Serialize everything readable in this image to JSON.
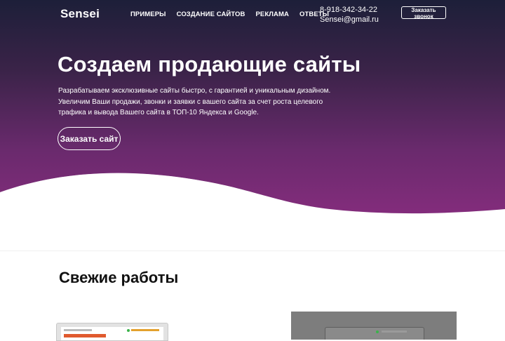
{
  "header": {
    "logo": "Sensei",
    "nav": [
      {
        "label": "ПРИМЕРЫ"
      },
      {
        "label": "СОЗДАНИЕ САЙТОВ"
      },
      {
        "label": "РЕКЛАМА"
      },
      {
        "label": "ОТВЕТЫ"
      }
    ],
    "phone": "8-918-342-34-22",
    "email": "Sensei@gmail.ru",
    "call_button": "Заказать звонок"
  },
  "hero": {
    "title": "Создаем продающие сайты",
    "description": "Разрабатываем эксклюзивные сайты быстро, с гарантией и уникальным дизайном. Увеличим Ваши продажи, звонки и заявки с вашего сайта за счет роста целевого трафика и вывода Вашего сайта в ТОП-10 Яндекса и Google.",
    "order_button": "Заказать сайт"
  },
  "works": {
    "title": "Свежие работы"
  },
  "colors": {
    "hero_top": "#1d1f39",
    "hero_bottom": "#8a2d80",
    "wave_accent": "#c48cc4",
    "text_on_hero": "#ffffff",
    "section_text": "#111111"
  }
}
